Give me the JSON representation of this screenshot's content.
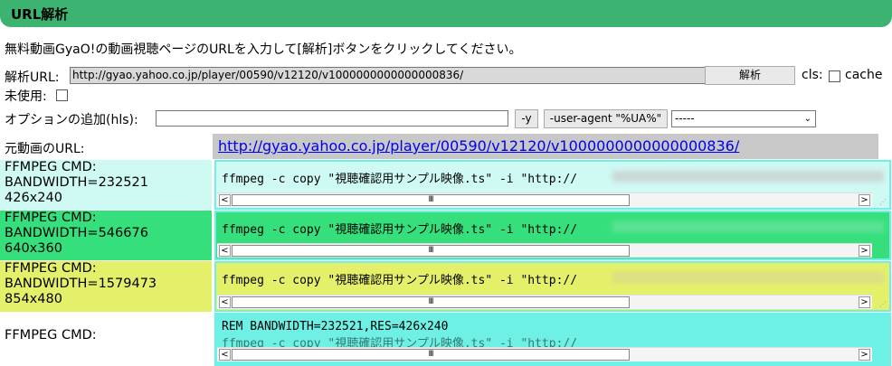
{
  "header": {
    "title": "URL解析"
  },
  "intro": "無料動画GyaO!の動画視聴ページのURLを入力して[解析]ボタンをクリックしてください。",
  "form": {
    "url_label": "解析URL:",
    "url_value": "http://gyao.yahoo.co.jp/player/00590/v12120/v1000000000000000836/",
    "analyze_button": "解析",
    "cls_label": "cls:",
    "cache_label": "cache",
    "unused_label": "未使用:",
    "options_label": "オプションの追加(hls):",
    "y_button": "-y",
    "ua_button": "-user-agent \"%UA%\"",
    "select_value": "-----"
  },
  "source": {
    "label": "元動画のURL:",
    "url": "http://gyao.yahoo.co.jp/player/00590/v12120/v1000000000000000836/"
  },
  "rows": [
    {
      "cmd_label": "FFMPEG CMD:",
      "bandwidth": "BANDWIDTH=232521",
      "res": "426x240",
      "command": "ffmpeg -c copy \"視聴確認用サンプル映像.ts\" -i \"http://",
      "bg": "#cff9f3"
    },
    {
      "cmd_label": "FFMPEG CMD:",
      "bandwidth": "BANDWIDTH=546676",
      "res": "640x360",
      "command": "ffmpeg -c copy \"視聴確認用サンプル映像.ts\" -i \"http://",
      "bg": "#35e07c"
    },
    {
      "cmd_label": "FFMPEG CMD:",
      "bandwidth": "BANDWIDTH=1579473",
      "res": "854x480",
      "command": "ffmpeg -c copy \"視聴確認用サンプル映像.ts\" -i \"http://",
      "bg": "#e4f06a"
    },
    {
      "cmd_label": "FFMPEG CMD:",
      "rem_line": "REM BANDWIDTH=232521,RES=426x240",
      "command": "ffmpeg -c copy \"視聴確認用サンプル映像.ts\" -i \"http://",
      "bg": "#ffffff"
    }
  ],
  "scroll_thumb": "III",
  "colors": {
    "header": "#3cb371",
    "pane_border": "#6ef0e4",
    "link": "#0000ee"
  }
}
